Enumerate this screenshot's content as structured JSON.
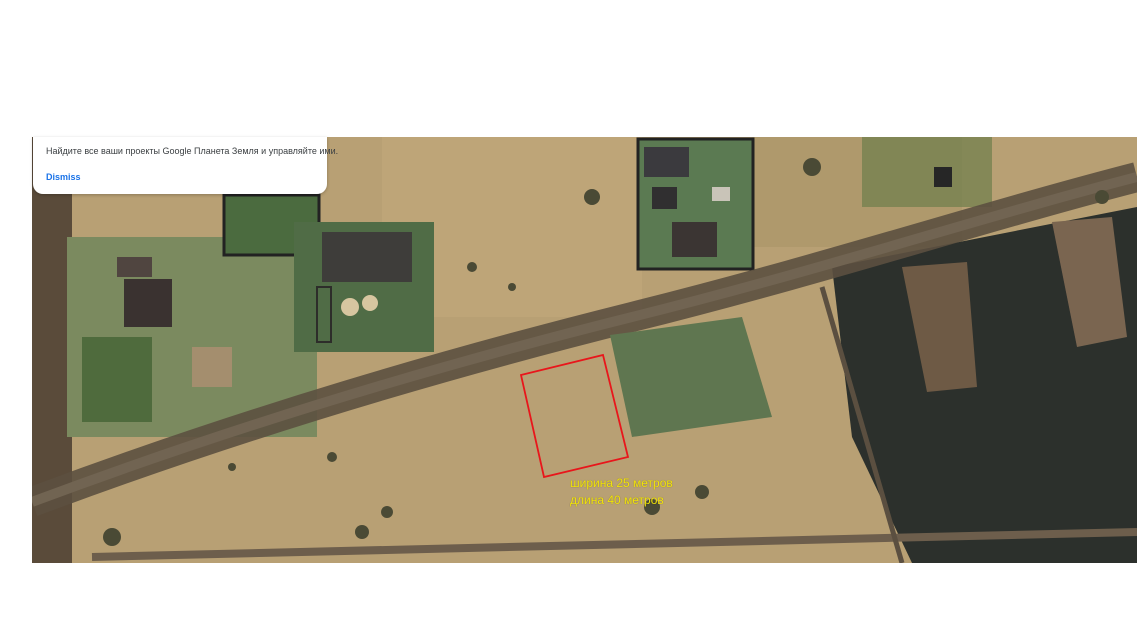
{
  "notice": {
    "message": "Найдите все ваши проекты Google Планета Земля и управляйте ими.",
    "dismiss_label": "Dismiss"
  },
  "annotation": {
    "width_text": "ширина 25 метров",
    "length_text": "длина 40 метров",
    "outline_color": "#e8161b",
    "text_color": "#f2e40a"
  },
  "imagery": {
    "type": "satellite",
    "features": [
      "dirt-road",
      "fenced-plots",
      "houses",
      "burned-field",
      "marked-plot"
    ]
  }
}
